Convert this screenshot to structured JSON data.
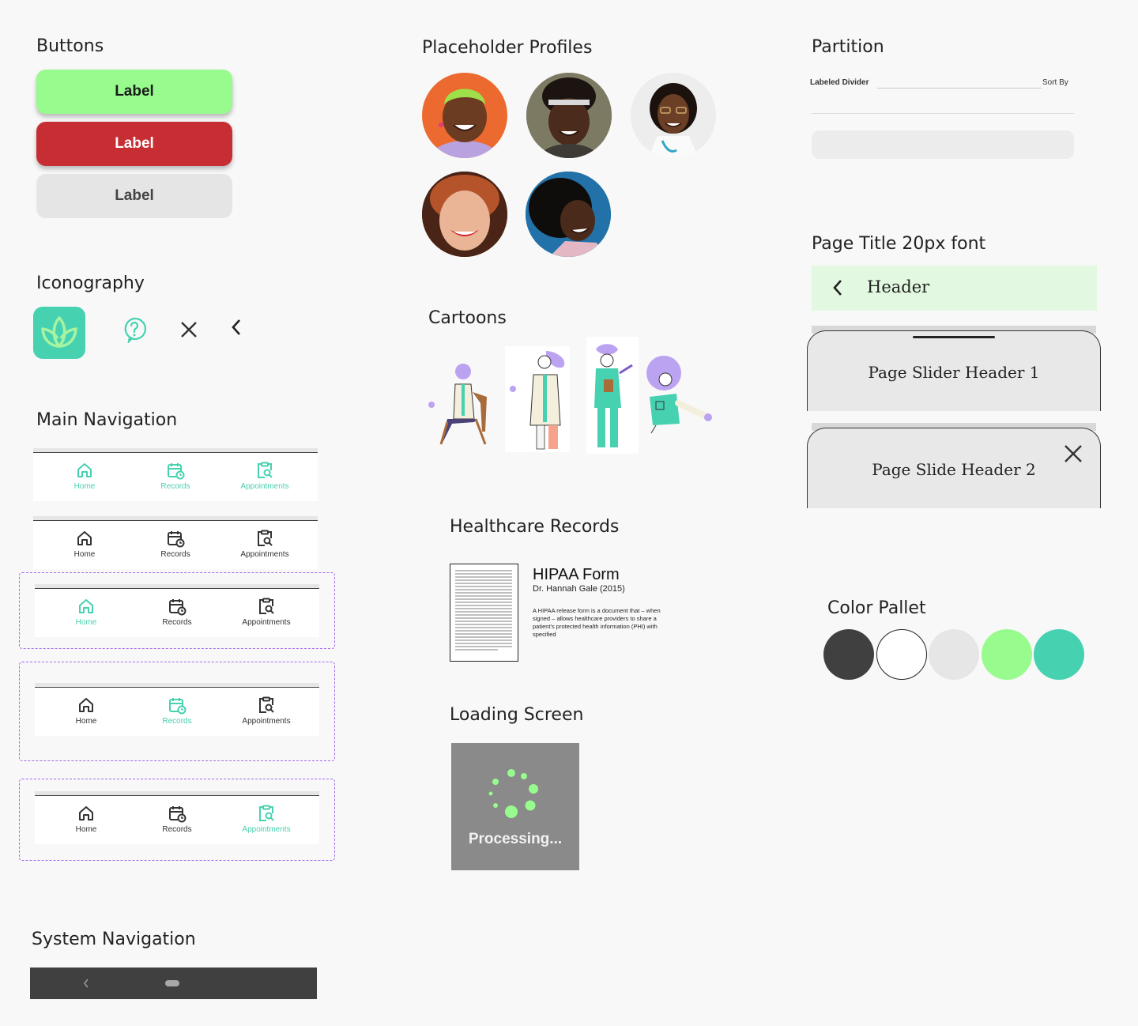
{
  "buttons": {
    "title": "Buttons",
    "primary_label": "Label",
    "danger_label": "Label",
    "secondary_label": "Label"
  },
  "iconography": {
    "title": "Iconography",
    "icons": [
      "lotus-logo-icon",
      "help-circle-icon",
      "close-icon",
      "chevron-left-icon"
    ]
  },
  "main_navigation": {
    "title": "Main Navigation",
    "items": [
      "Home",
      "Records",
      "Appointments"
    ]
  },
  "system_navigation": {
    "title": "System Navigation"
  },
  "profiles": {
    "title": "Placeholder Profiles"
  },
  "cartoons": {
    "title": "Cartoons"
  },
  "records": {
    "title": "Healthcare Records",
    "form_title": "HIPAA Form",
    "form_author": "Dr. Hannah Gale (2015)",
    "form_description": "A HIPAA release form is a document that – when signed – allows healthcare providers to share a patient's protected health information (PHI) with specified"
  },
  "loading": {
    "title": "Loading Screen",
    "text": "Processing..."
  },
  "partition": {
    "title": "Partition",
    "divider_label": "Labeled Divider",
    "sort_label": "Sort By"
  },
  "page_title": {
    "title": "Page Title 20px font",
    "header": "Header",
    "slider1": "Page Slider Header 1",
    "slider2": "Page Slide Header 2"
  },
  "colors": {
    "title": "Color Pallet",
    "swatches": [
      "#404040",
      "#ffffff",
      "#e6e6e6",
      "#98fb8d",
      "#46d1b0"
    ]
  }
}
